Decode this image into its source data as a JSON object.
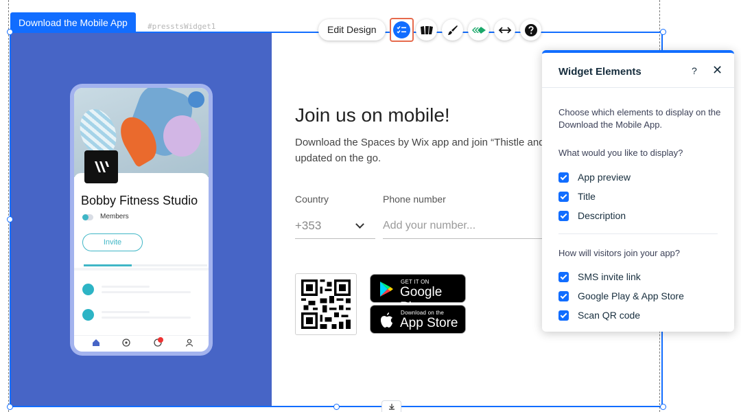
{
  "widget": {
    "tag_label": "Download the Mobile App",
    "id_label": "#presstsWidget1"
  },
  "toolbar": {
    "edit_design_label": "Edit Design",
    "tools": [
      {
        "name": "elements-icon"
      },
      {
        "name": "layouts-icon"
      },
      {
        "name": "design-brush-icon"
      },
      {
        "name": "connect-icon"
      },
      {
        "name": "stretch-icon"
      },
      {
        "name": "help-icon"
      }
    ]
  },
  "app_preview": {
    "studio_name": "Bobby Fitness Studio",
    "members_label": "Members",
    "invite_label": "Invite",
    "progress_fraction": 0.39
  },
  "content": {
    "title": "Join us on mobile!",
    "description": "Download the Spaces by Wix app and join “Thistle and",
    "description_line2": "updated on the go.",
    "country_label": "Country",
    "country_value": "+353",
    "phone_label": "Phone number",
    "phone_placeholder": "Add your number...",
    "google_play": {
      "small": "GET IT ON",
      "big": "Google Play"
    },
    "app_store": {
      "small": "Download on the",
      "big": "App Store"
    }
  },
  "panel": {
    "title": "Widget Elements",
    "help": "?",
    "close": "✕",
    "intro": "Choose which elements to display on the Download the Mobile App.",
    "display_question": "What would you like to display?",
    "display_options": [
      {
        "label": "App preview",
        "checked": true
      },
      {
        "label": "Title",
        "checked": true
      },
      {
        "label": "Description",
        "checked": true
      }
    ],
    "join_question": "How will visitors join your app?",
    "join_options": [
      {
        "label": "SMS invite link",
        "checked": true
      },
      {
        "label": "Google Play & App Store",
        "checked": true
      },
      {
        "label": "Scan QR code",
        "checked": true
      }
    ]
  },
  "colors": {
    "accent": "#116dff",
    "left_bg": "#4765c6",
    "teal": "#3fb6c6",
    "highlight": "#e66a4c"
  }
}
